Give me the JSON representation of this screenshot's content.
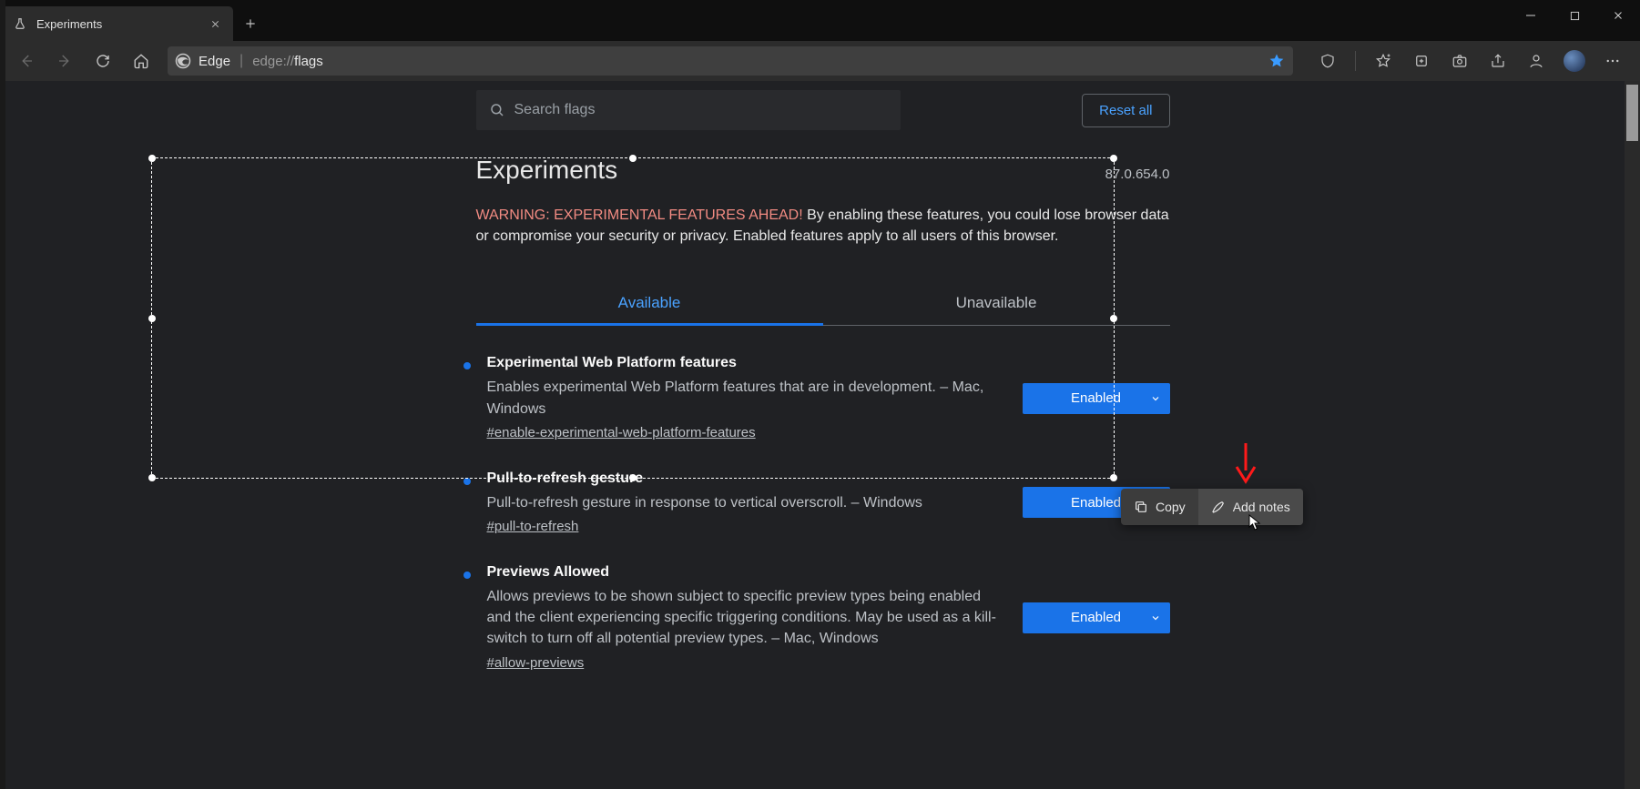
{
  "titlebar": {
    "tab_title": "Experiments"
  },
  "addressbar": {
    "origin_label": "Edge",
    "url_scheme": "edge://",
    "url_path": "flags"
  },
  "search": {
    "placeholder": "Search flags",
    "reset_label": "Reset all"
  },
  "header": {
    "title": "Experiments",
    "version": "87.0.654.0",
    "warning_red": "WARNING: EXPERIMENTAL FEATURES AHEAD!",
    "warning_rest": " By enabling these features, you could lose browser data or compromise your security or privacy. Enabled features apply to all users of this browser."
  },
  "tabs": {
    "available": "Available",
    "unavailable": "Unavailable"
  },
  "flags": [
    {
      "title": "Experimental Web Platform features",
      "desc": "Enables experimental Web Platform features that are in development. – Mac, Windows",
      "tag": "#enable-experimental-web-platform-features",
      "state": "Enabled"
    },
    {
      "title": "Pull-to-refresh gesture",
      "desc": "Pull-to-refresh gesture in response to vertical overscroll. – Windows",
      "tag": "#pull-to-refresh",
      "state": "Enabled"
    },
    {
      "title": "Previews Allowed",
      "desc": "Allows previews to be shown subject to specific preview types being enabled and the client experiencing specific triggering conditions. May be used as a kill-switch to turn off all potential preview types. – Mac, Windows",
      "tag": "#allow-previews",
      "state": "Enabled"
    }
  ],
  "toolbar": {
    "copy": "Copy",
    "add_notes": "Add notes"
  }
}
